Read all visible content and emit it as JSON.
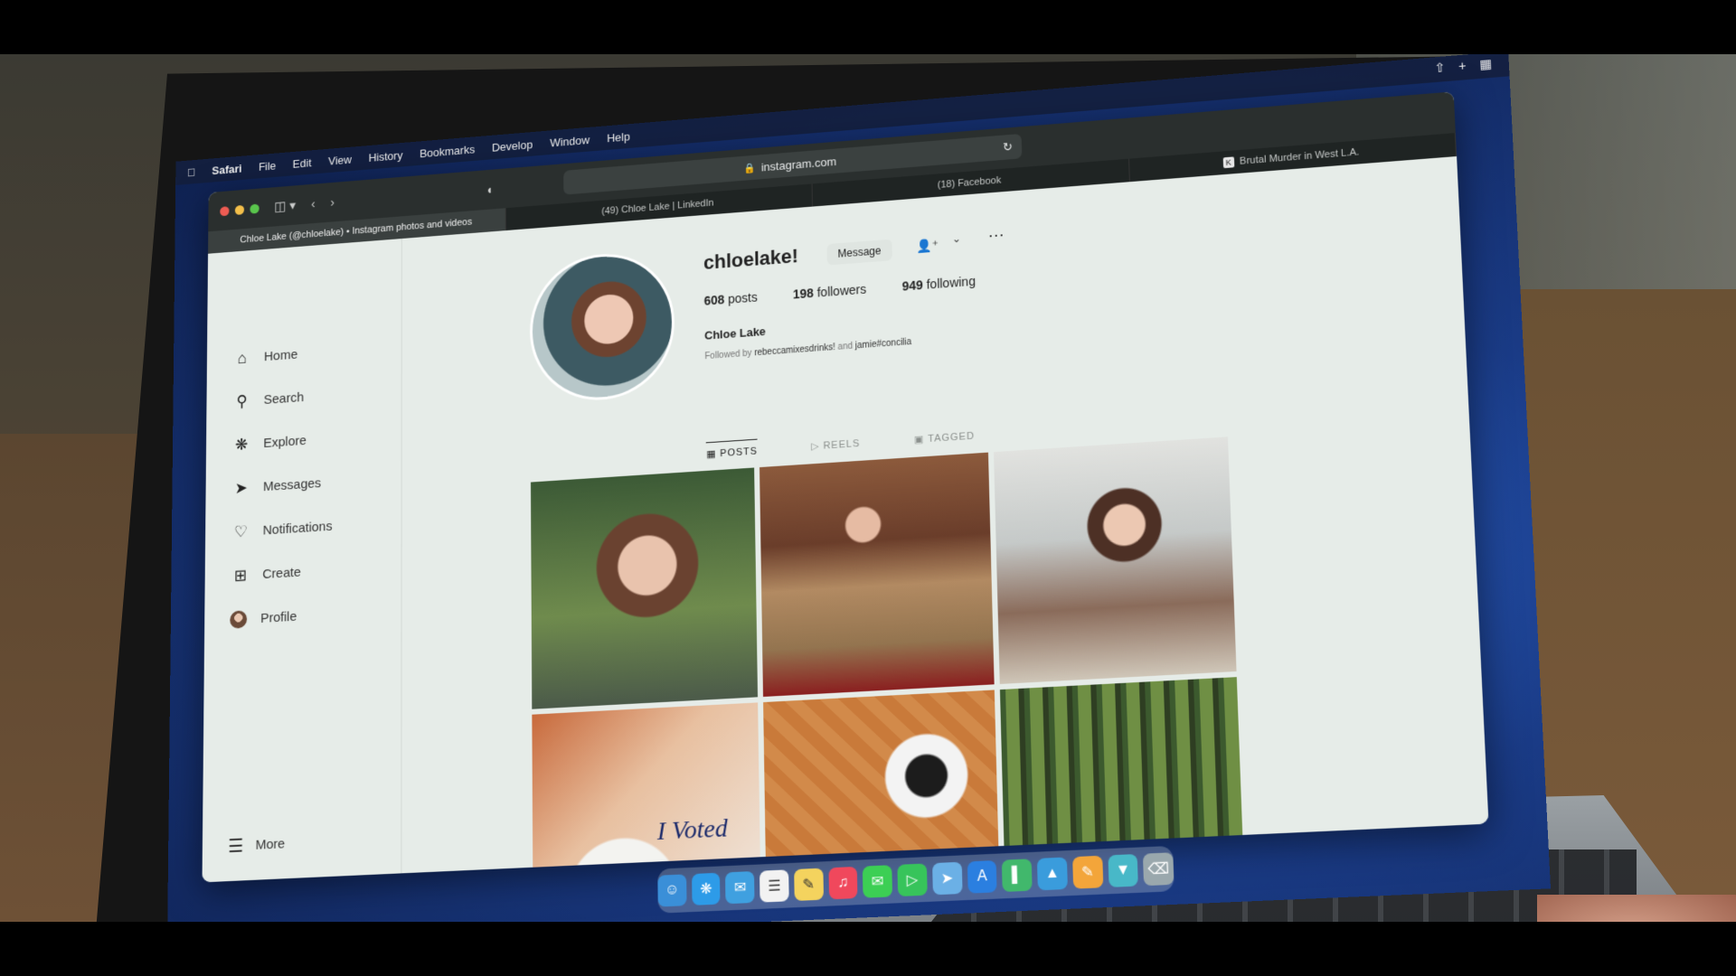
{
  "menubar": {
    "app": "Safari",
    "items": [
      "File",
      "Edit",
      "View",
      "History",
      "Bookmarks",
      "Develop",
      "Window",
      "Help"
    ],
    "tools": [
      "share-icon",
      "plus-icon",
      "tab-overview-icon"
    ]
  },
  "browser": {
    "url": "instagram.com",
    "tabs": [
      {
        "label": "Chloe Lake (@chloelake) • Instagram photos and videos",
        "active": true
      },
      {
        "label": "(49) Chloe Lake | LinkedIn",
        "active": false
      },
      {
        "label": "(18) Facebook",
        "active": false
      },
      {
        "label": "Brutal Murder in West L.A.",
        "active": false
      }
    ]
  },
  "sidebar": {
    "items": [
      {
        "label": "Home",
        "icon": "home-icon"
      },
      {
        "label": "Search",
        "icon": "search-icon"
      },
      {
        "label": "Explore",
        "icon": "compass-icon"
      },
      {
        "label": "Messages",
        "icon": "send-icon"
      },
      {
        "label": "Notifications",
        "icon": "heart-icon"
      },
      {
        "label": "Create",
        "icon": "plus-square-icon"
      },
      {
        "label": "Profile",
        "icon": "avatar"
      }
    ],
    "more": "More"
  },
  "profile": {
    "username": "chloelake!",
    "message_label": "Message",
    "posts": "608",
    "posts_label": "posts",
    "followers": "198",
    "followers_label": "followers",
    "following": "949",
    "following_label": "following",
    "full_name": "Chloe Lake",
    "followed_by_prefix": "Followed by",
    "followed_by_1": "rebeccamixesdrinks!",
    "followed_by_join": "and",
    "followed_by_2": "jamie#concilia"
  },
  "ig_tabs": [
    "POSTS",
    "REELS",
    "TAGGED"
  ],
  "posts_grid": [
    {
      "subject": "selfie in forest"
    },
    {
      "subject": "woman on bench"
    },
    {
      "subject": "woman in clothing store"
    },
    {
      "subject": "I Voted sticker",
      "text": "I Voted"
    },
    {
      "subject": "puppy"
    },
    {
      "subject": "forest trees"
    }
  ],
  "colors": {
    "accent": "#2a5fc4",
    "page_bg": "#e6ece8"
  }
}
